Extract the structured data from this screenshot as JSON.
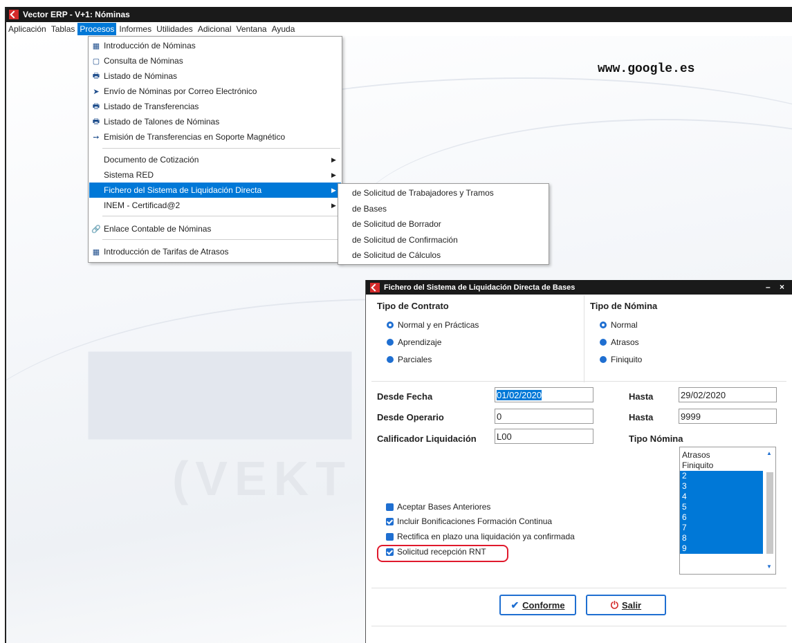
{
  "window": {
    "title": "Vector ERP - V+1: Nóminas"
  },
  "menubar": {
    "items": [
      "Aplicación",
      "Tablas",
      "Procesos",
      "Informes",
      "Utilidades",
      "Adicional",
      "Ventana",
      "Ayuda"
    ],
    "active": "Procesos"
  },
  "background": {
    "url_text": "www.google.es"
  },
  "procesos_menu": {
    "items": [
      {
        "label": "Introducción de Nóminas",
        "icon": "grid-icon"
      },
      {
        "label": "Consulta de Nóminas",
        "icon": "window-icon"
      },
      {
        "label": "Listado de Nóminas",
        "icon": "printer-icon"
      },
      {
        "label": "Envío de Nóminas por Correo Electrónico",
        "icon": "send-icon"
      },
      {
        "label": "Listado de Transferencias",
        "icon": "printer-icon"
      },
      {
        "label": "Listado de Talones de Nóminas",
        "icon": "printer-icon"
      },
      {
        "label": "Emisión de Transferencias en Soporte Magnético",
        "icon": "arrow-icon"
      },
      {
        "label": "Documento de Cotización",
        "submenu": true
      },
      {
        "label": "Sistema RED",
        "submenu": true
      },
      {
        "label": "Fichero del Sistema de Liquidación Directa",
        "submenu": true,
        "highlighted": true
      },
      {
        "label": "INEM - Certificad@2",
        "submenu": true
      },
      {
        "label": "Enlace Contable de Nóminas",
        "icon": "link-icon"
      },
      {
        "label": "Introducción de Tarifas de Atrasos",
        "icon": "grid-icon"
      }
    ]
  },
  "fichero_submenu": {
    "items": [
      "de Solicitud de Trabajadores y Tramos",
      "de Bases",
      "de Solicitud de Borrador",
      "de Solicitud de Confirmación",
      "de Solicitud de Cálculos"
    ]
  },
  "dialog": {
    "title": "Fichero del Sistema de Liquidación Directa de Bases",
    "minimize": "–",
    "close": "×",
    "tipo_contrato": {
      "label": "Tipo de Contrato",
      "options": [
        "Normal y en Prácticas",
        "Aprendizaje",
        "Parciales"
      ],
      "selected": "Normal y en Prácticas"
    },
    "tipo_nomina": {
      "label": "Tipo de Nómina",
      "options": [
        "Normal",
        "Atrasos",
        "Finiquito"
      ],
      "selected": "Normal"
    },
    "desde_fecha": {
      "label": "Desde Fecha",
      "value": "01/02/2020"
    },
    "hasta_fecha": {
      "label": "Hasta",
      "value": "29/02/2020"
    },
    "desde_operario": {
      "label": "Desde Operario",
      "value": "0"
    },
    "hasta_operario": {
      "label": "Hasta",
      "value": "9999"
    },
    "calificador": {
      "label": "Calificador Liquidación",
      "value": "L00"
    },
    "tipo_nomina_list": {
      "label": "Tipo Nómina",
      "items": [
        "Atrasos",
        "Finiquito",
        "2",
        "3",
        "4",
        "5",
        "6",
        "7",
        "8",
        "9"
      ],
      "selected": [
        "2",
        "3",
        "4",
        "5",
        "6",
        "7",
        "8",
        "9"
      ]
    },
    "checkboxes": [
      {
        "label": "Aceptar Bases Anteriores",
        "checked": false
      },
      {
        "label": "Incluir Bonificaciones Formación Continua",
        "checked": true
      },
      {
        "label": "Rectifica en plazo una liquidación ya confirmada",
        "checked": false
      },
      {
        "label": "Solicitud recepción RNT",
        "checked": true
      }
    ],
    "buttons": {
      "ok": "Conforme",
      "exit": "Salir"
    }
  },
  "colors": {
    "accent": "#0078d7",
    "titlebar": "#1a1a1a",
    "logo": "#d42a2a",
    "highlight_oval": "#e0192c"
  }
}
